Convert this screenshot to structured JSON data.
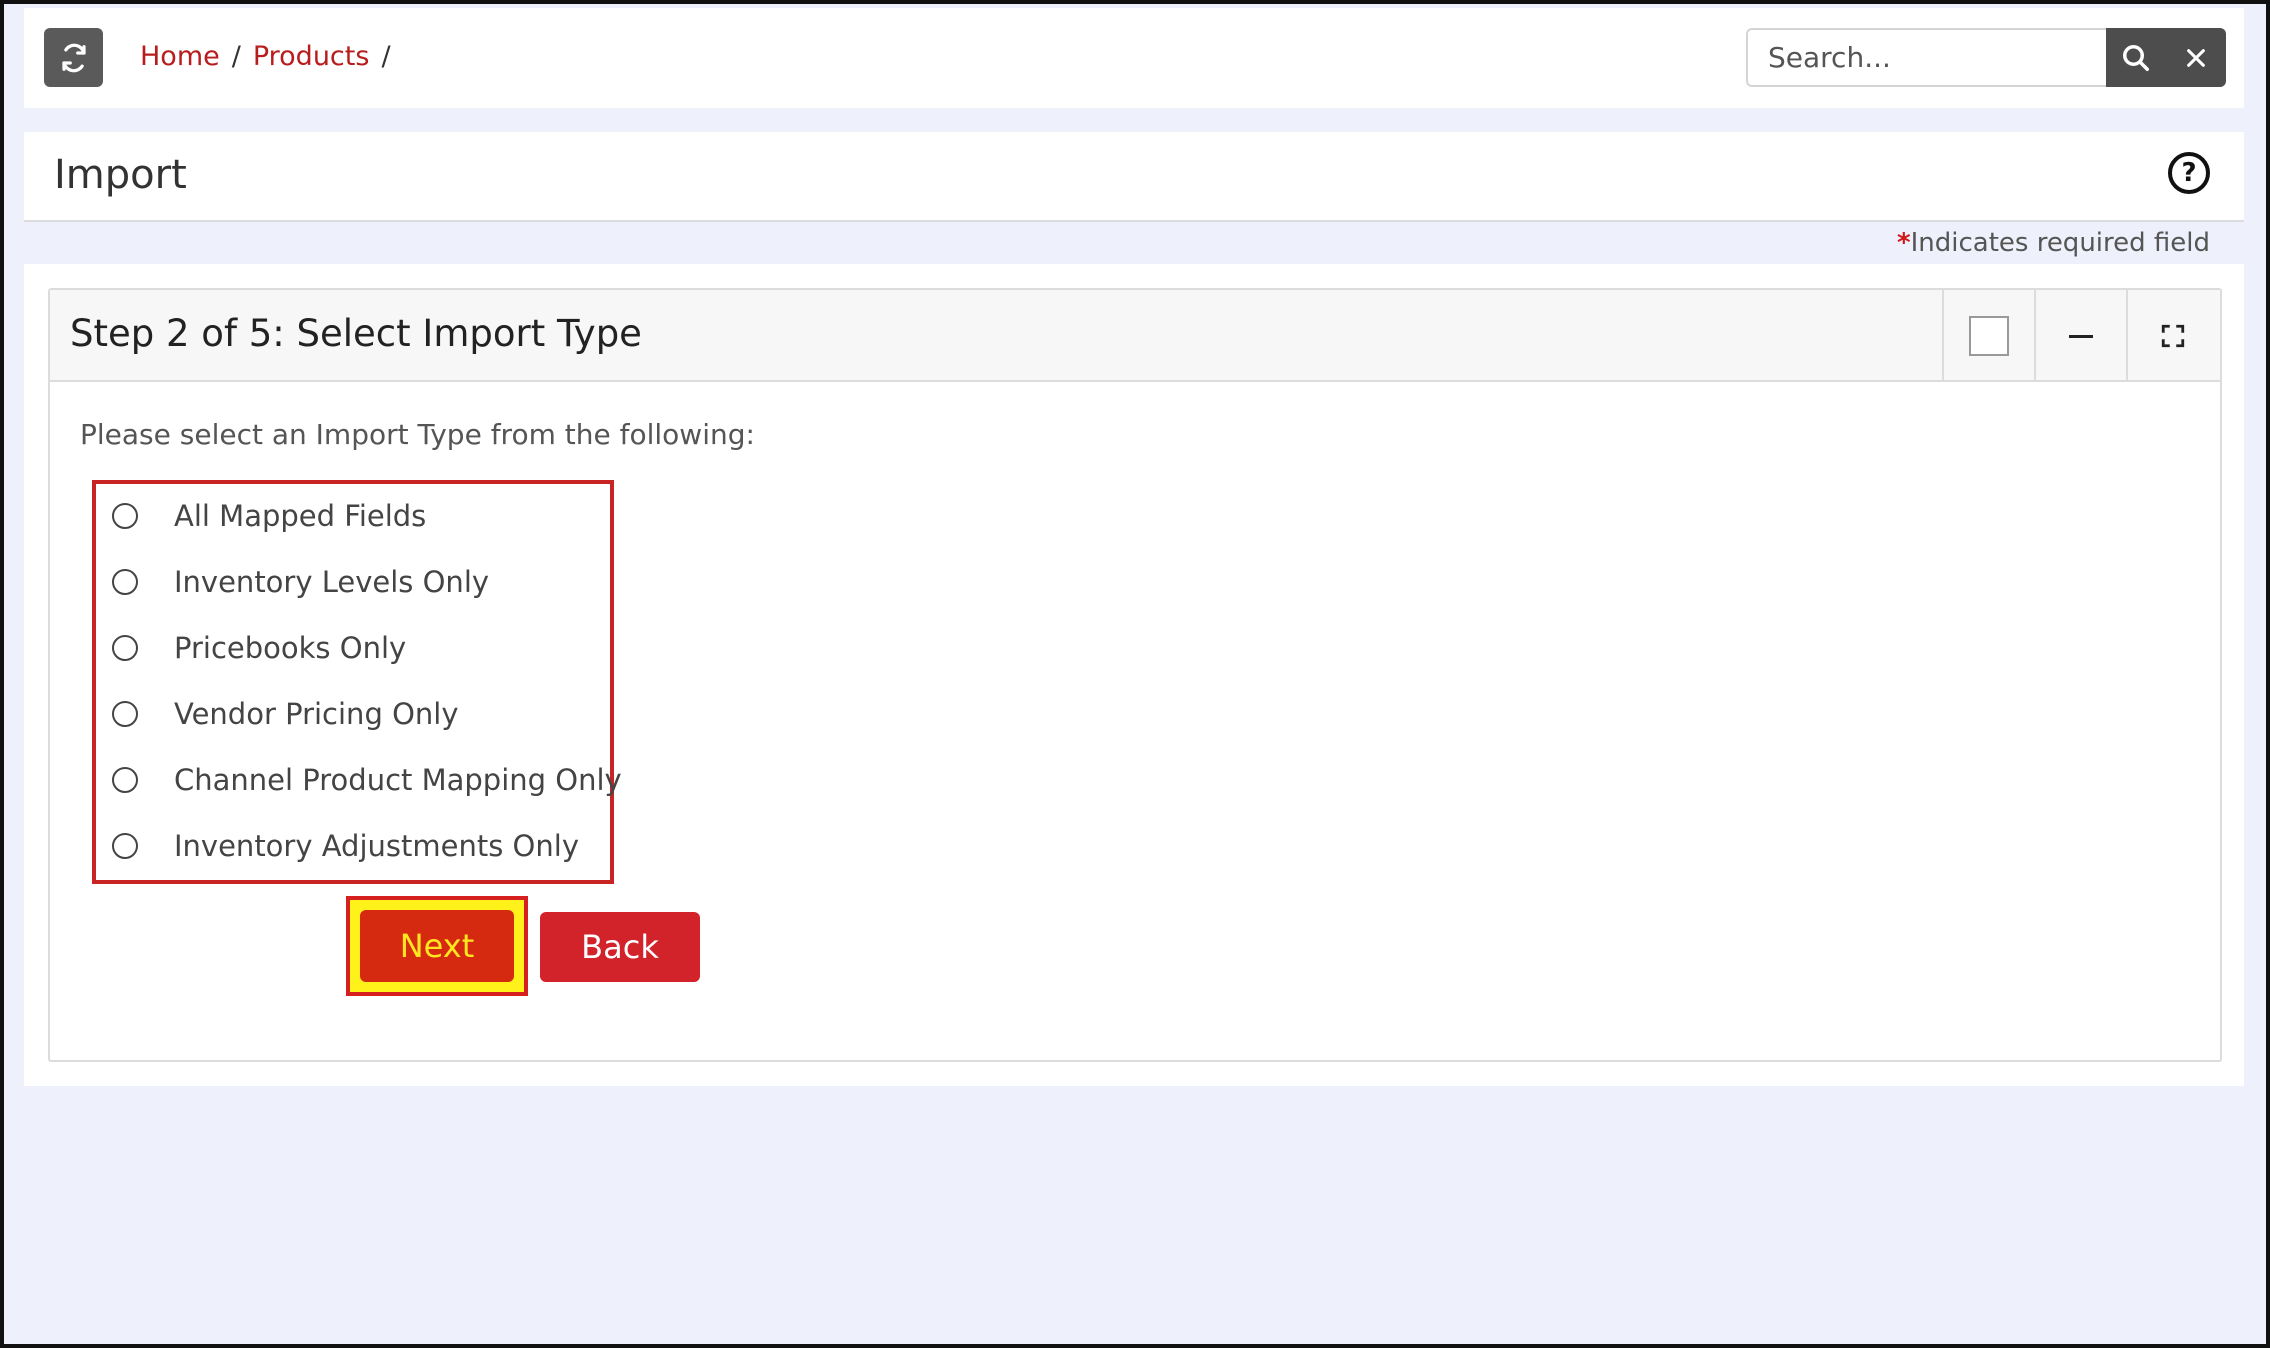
{
  "breadcrumb": {
    "items": [
      "Home",
      "Products"
    ],
    "separator": "/"
  },
  "search": {
    "placeholder": "Search...",
    "value": ""
  },
  "page": {
    "title": "Import"
  },
  "required_note": {
    "star": "*",
    "text": "Indicates required field"
  },
  "panel": {
    "title": "Step 2 of 5: Select Import Type",
    "instructions": "Please select an Import Type from the following:",
    "options": [
      "All Mapped Fields",
      "Inventory Levels Only",
      "Pricebooks Only",
      "Vendor Pricing Only",
      "Channel Product Mapping Only",
      "Inventory Adjustments Only"
    ]
  },
  "buttons": {
    "next": "Next",
    "back": "Back"
  },
  "icons": {
    "refresh": "refresh-icon",
    "search": "search-icon",
    "clear": "close-icon",
    "help": "help-icon",
    "minimize": "minimize-icon",
    "fullscreen": "fullscreen-icon"
  },
  "colors": {
    "accent": "#d2222a",
    "link": "#b81c1c",
    "highlight": "#fff21a"
  }
}
